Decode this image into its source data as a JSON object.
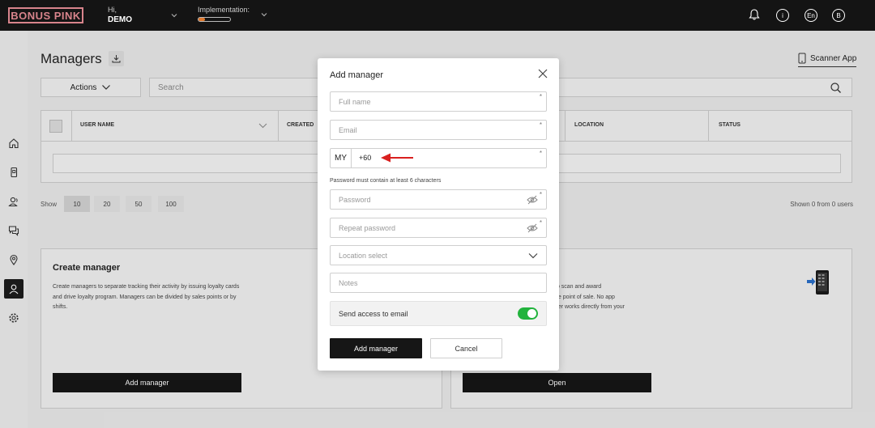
{
  "header": {
    "logo": "BONUS PINK",
    "greeting": "Hi,",
    "user": "DEMO",
    "implementation_label": "Implementation:",
    "implementation_progress": 0.2,
    "language": "En",
    "avatar_letter": "B",
    "info_glyph": "i"
  },
  "page": {
    "title": "Managers",
    "scanner_label": "Scanner App",
    "actions_label": "Actions",
    "search_placeholder": "Search"
  },
  "table": {
    "columns": [
      "USER NAME",
      "CREATED",
      "LOCATION",
      "STATUS"
    ]
  },
  "pagination": {
    "show_label": "Show",
    "options": [
      "10",
      "20",
      "50",
      "100"
    ],
    "selected": "10",
    "shown_text": "Shown 0 from 0 users"
  },
  "cards": {
    "create": {
      "title": "Create manager",
      "text": "Create managers to separate tracking their activity by issuing loyalty cards and drive loyalty program. Managers can be divided by sales points or by shifts.",
      "button": "Add manager"
    },
    "scanner": {
      "text_lines": [
        "to scan and award",
        "he point of sale.  No app",
        "ner works directly from your"
      ],
      "button": "Open"
    }
  },
  "modal": {
    "title": "Add manager",
    "full_name_placeholder": "Full name",
    "email_placeholder": "Email",
    "country_code": "MY",
    "dial_code": "+60",
    "password_hint": "Password must contain at least 6 characters",
    "password_placeholder": "Password",
    "repeat_password_placeholder": "Repeat password",
    "location_placeholder": "Location select",
    "notes_placeholder": "Notes",
    "send_access_label": "Send access to email",
    "send_access_enabled": true,
    "submit_label": "Add manager",
    "cancel_label": "Cancel",
    "required_mark": "*"
  },
  "colors": {
    "logo": "#d8848c",
    "toggle_on": "#22b33d",
    "annotation_arrow": "#d9201f",
    "primary_button": "#161616"
  }
}
